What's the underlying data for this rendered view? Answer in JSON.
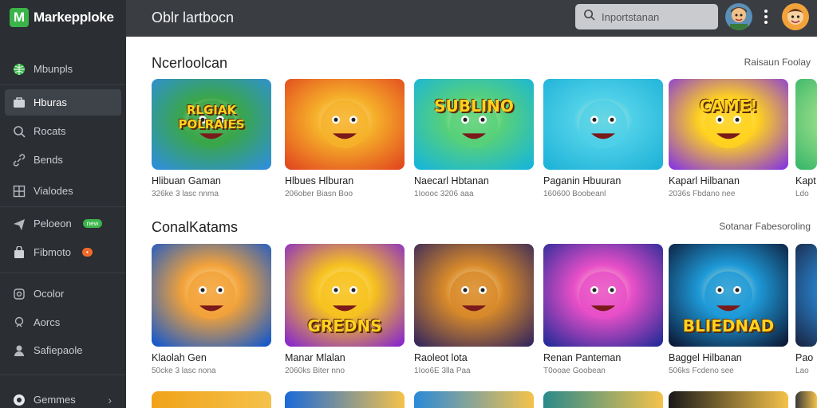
{
  "app": {
    "name": "Markepploke",
    "logo_letter": "M"
  },
  "topbar": {
    "title": "Oblr lartbocn",
    "search_placeholder": "Inportstanan"
  },
  "sidebar": {
    "items": [
      {
        "label": "Mbunpls",
        "icon": "globe-icon"
      },
      {
        "label": "Hburas",
        "icon": "briefcase-icon",
        "active": true
      },
      {
        "label": "Rocats",
        "icon": "search-icon"
      },
      {
        "label": "Bends",
        "icon": "link-icon"
      },
      {
        "label": "Vialodes",
        "icon": "grid-icon"
      },
      {
        "label": "Peloeon",
        "icon": "plane-icon",
        "badge": "new"
      },
      {
        "label": "Fibmoto",
        "icon": "bag-icon",
        "badge": "•"
      },
      {
        "label": "Ocolor",
        "icon": "coin-icon"
      },
      {
        "label": "Aorcs",
        "icon": "bulb-icon"
      },
      {
        "label": "Safiepaole",
        "icon": "person-icon"
      },
      {
        "label": "Gemmes",
        "icon": "gamepad-icon"
      }
    ]
  },
  "sections": [
    {
      "title": "Ncerloolcan",
      "link": "Raisaun Foolay",
      "cards": [
        {
          "title": "Hlibuan Gaman",
          "sub": "326ke 3 lasc nnma",
          "art": "RLGIAK POLRAIES",
          "colors": [
            "#2f8fd8",
            "#3aa64a"
          ]
        },
        {
          "title": "Hlbues Hlburan",
          "sub": "206ober Biasn Boo",
          "art": "",
          "colors": [
            "#e24a1f",
            "#f6b12a"
          ]
        },
        {
          "title": "Naecarl Hbtanan",
          "sub": "1Ioooc 3206 aaa",
          "art": "SUBLINO",
          "colors": [
            "#18b6d8",
            "#57d07a"
          ]
        },
        {
          "title": "Paganin Hbuuran",
          "sub": "160600 Boobeanl",
          "art": "",
          "colors": [
            "#1fb3d8",
            "#4fd0e8"
          ]
        },
        {
          "title": "Kaparl Hilbanan",
          "sub": "2036s Fbdano nee",
          "art": "CAME!",
          "colors": [
            "#8a3cd8",
            "#ffd21f"
          ]
        },
        {
          "title": "Kapt",
          "sub": "Ldo",
          "art": "",
          "colors": [
            "#3cb86a",
            "#9ee08a"
          ]
        }
      ]
    },
    {
      "title": "ConalKatams",
      "link": "Sotanar Fabesoroling",
      "cards": [
        {
          "title": "Klaolah Gen",
          "sub": "50cke 3 lasc nona",
          "art": "",
          "colors": [
            "#1a5ac8",
            "#f2a23a"
          ]
        },
        {
          "title": "Manar Mlalan",
          "sub": "2060ks Biter nno",
          "art": "GREDNS",
          "colors": [
            "#8a2cc8",
            "#f7c21f"
          ]
        },
        {
          "title": "Raoleot lota",
          "sub": "1Ioo6E 3lla Paa",
          "art": "",
          "colors": [
            "#3a2a5a",
            "#d88a2a"
          ]
        },
        {
          "title": "Renan Panteman",
          "sub": "T0ooae Goobean",
          "art": "",
          "colors": [
            "#2a2c9a",
            "#e84fc8"
          ]
        },
        {
          "title": "Baggel Hilbanan",
          "sub": "506ks Fcdeno see",
          "art": "BLIEDNAD",
          "colors": [
            "#0d1c3a",
            "#1e9ad8"
          ]
        },
        {
          "title": "Pao",
          "sub": "Lao",
          "art": "",
          "colors": [
            "#1a2a4a",
            "#2a8ad8"
          ]
        }
      ]
    }
  ],
  "bottom_row_colors": [
    "#f2a21a",
    "#1a6ad8",
    "#2a8ad8",
    "#2a8a8a",
    "#1a1a1a",
    "#3a3a3a"
  ]
}
